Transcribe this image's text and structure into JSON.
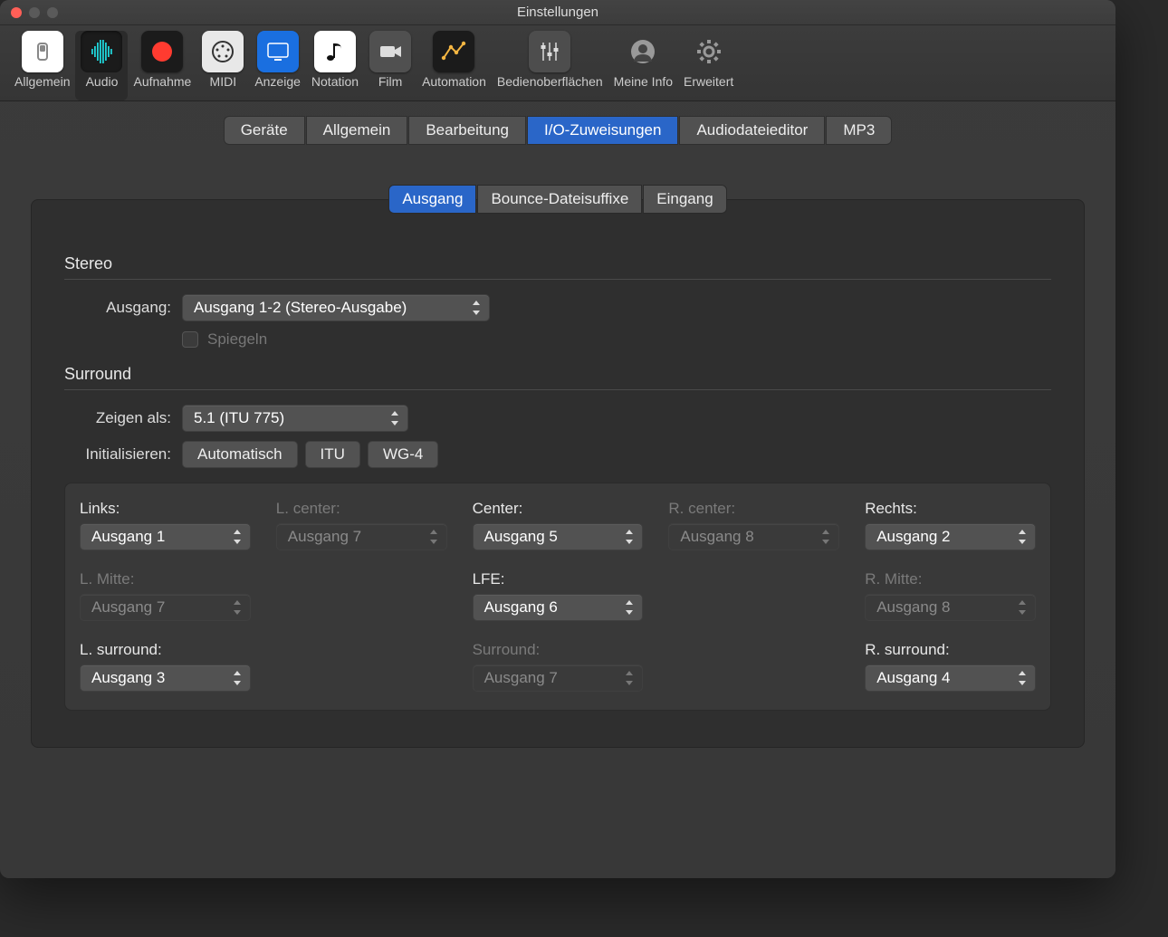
{
  "window": {
    "title": "Einstellungen"
  },
  "toolbar": [
    {
      "label": "Allgemein",
      "iconBg": "#ffffff",
      "glyphColor": "#888",
      "shape": "switch"
    },
    {
      "label": "Audio",
      "iconBg": "#1b1b1b",
      "glyphColor": "#1fd4d9",
      "shape": "waveform",
      "selected": true
    },
    {
      "label": "Aufnahme",
      "iconBg": "#1b1b1b",
      "glyphColor": "#ff3b30",
      "shape": "record"
    },
    {
      "label": "MIDI",
      "iconBg": "#e8e8e8",
      "glyphColor": "#333",
      "shape": "midi"
    },
    {
      "label": "Anzeige",
      "iconBg": "#1a6fe0",
      "glyphColor": "#fff",
      "shape": "display"
    },
    {
      "label": "Notation",
      "iconBg": "#ffffff",
      "glyphColor": "#111",
      "shape": "note"
    },
    {
      "label": "Film",
      "iconBg": "#505050",
      "glyphColor": "#ddd",
      "shape": "camera"
    },
    {
      "label": "Automation",
      "iconBg": "#1b1b1b",
      "glyphColor": "#f5b642",
      "shape": "automation"
    },
    {
      "label": "Bedienoberflächen",
      "iconBg": "#4d4d4d",
      "glyphColor": "#ddd",
      "shape": "faders"
    },
    {
      "label": "Meine Info",
      "iconBg": "transparent",
      "glyphColor": "#999",
      "shape": "user"
    },
    {
      "label": "Erweitert",
      "iconBg": "transparent",
      "glyphColor": "#999",
      "shape": "gear"
    }
  ],
  "mainTabs": [
    {
      "label": "Geräte"
    },
    {
      "label": "Allgemein"
    },
    {
      "label": "Bearbeitung"
    },
    {
      "label": "I/O-Zuweisungen",
      "active": true
    },
    {
      "label": "Audiodateieditor"
    },
    {
      "label": "MP3"
    }
  ],
  "subTabs": [
    {
      "label": "Ausgang",
      "active": true
    },
    {
      "label": "Bounce-Dateisuffixe"
    },
    {
      "label": "Eingang"
    }
  ],
  "stereo": {
    "heading": "Stereo",
    "outputLabel": "Ausgang:",
    "outputValue": "Ausgang 1-2 (Stereo-Ausgabe)",
    "mirrorLabel": "Spiegeln"
  },
  "surround": {
    "heading": "Surround",
    "showAsLabel": "Zeigen als:",
    "showAsValue": "5.1 (ITU 775)",
    "initLabel": "Initialisieren:",
    "initButtons": [
      "Automatisch",
      "ITU",
      "WG-4"
    ],
    "channels": [
      [
        {
          "label": "Links:",
          "value": "Ausgang 1",
          "disabled": false
        },
        {
          "label": "L. center:",
          "value": "Ausgang 7",
          "disabled": true
        },
        {
          "label": "Center:",
          "value": "Ausgang 5",
          "disabled": false
        },
        {
          "label": "R. center:",
          "value": "Ausgang 8",
          "disabled": true
        },
        {
          "label": "Rechts:",
          "value": "Ausgang 2",
          "disabled": false
        }
      ],
      [
        {
          "label": "L. Mitte:",
          "value": "Ausgang 7",
          "disabled": true
        },
        null,
        {
          "label": "LFE:",
          "value": "Ausgang 6",
          "disabled": false
        },
        null,
        {
          "label": "R. Mitte:",
          "value": "Ausgang 8",
          "disabled": true
        }
      ],
      [
        {
          "label": "L. surround:",
          "value": "Ausgang 3",
          "disabled": false
        },
        null,
        {
          "label": "Surround:",
          "value": "Ausgang 7",
          "disabled": true
        },
        null,
        {
          "label": "R. surround:",
          "value": "Ausgang 4",
          "disabled": false
        }
      ]
    ]
  }
}
